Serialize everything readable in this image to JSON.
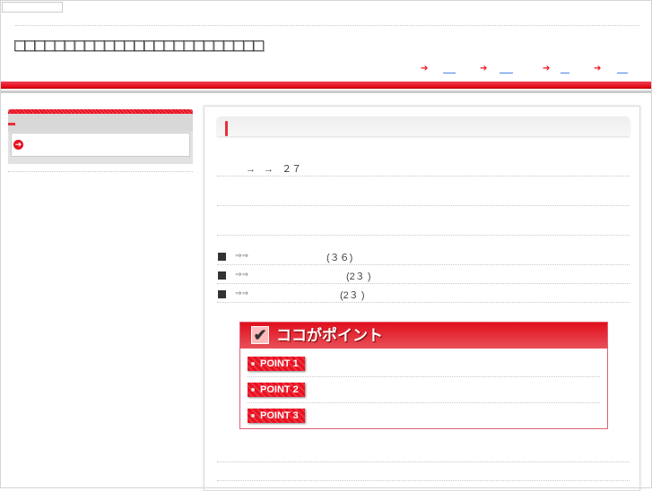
{
  "header": {
    "title": "□□□□□□□□□□□□□□□□□□□□□□□□□",
    "nav": [
      {
        "arrow": "➔"
      },
      {
        "arrow": "➔"
      },
      {
        "arrow": "➔"
      },
      {
        "arrow": "➔"
      }
    ]
  },
  "sidebar": {
    "item_icon": "➔"
  },
  "main": {
    "intro": "→ → ２７",
    "list": [
      {
        "arrows": "⇒⇒",
        "count": "(３６)"
      },
      {
        "arrows": "⇒⇒",
        "count": "(2３ )"
      },
      {
        "arrows": "⇒⇒",
        "count": "(2３ )"
      }
    ],
    "point_box": {
      "title": "ココがポイント",
      "check": "✔",
      "points": [
        "POINT 1",
        "POINT 2",
        "POINT 3"
      ]
    }
  },
  "colors": {
    "accent": "#e8101e",
    "link": "#4a7fe8"
  }
}
